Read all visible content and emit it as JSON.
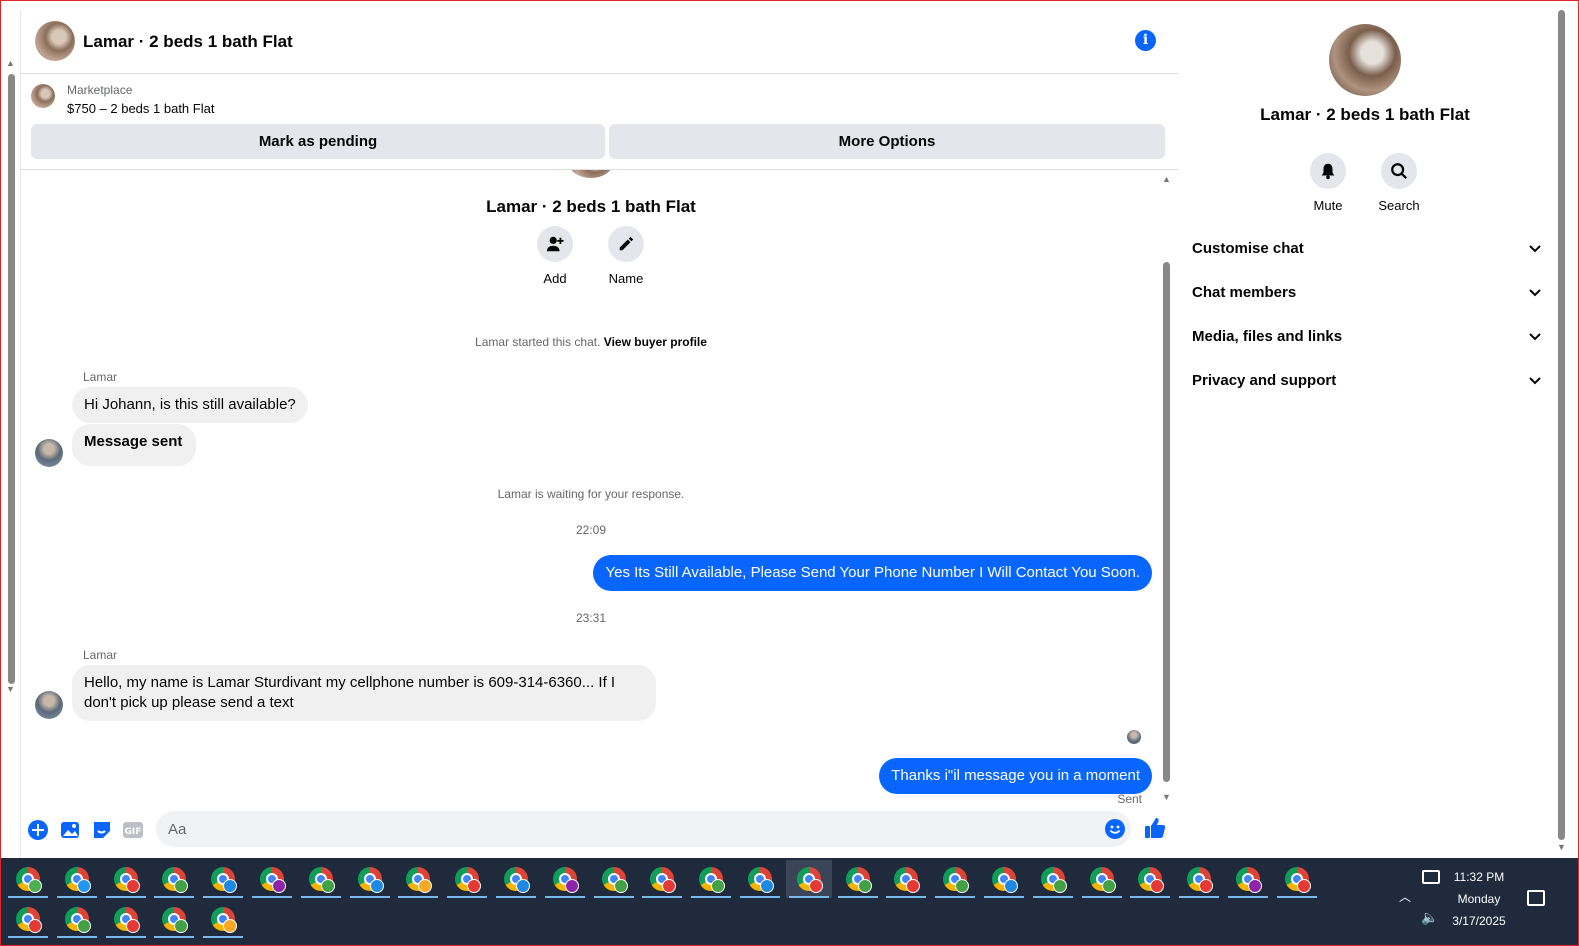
{
  "header": {
    "title": "Lamar · 2 beds 1 bath Flat"
  },
  "marketplace": {
    "label": "Marketplace",
    "listing": "$750 – 2 beds 1 bath Flat",
    "mark_pending": "Mark as pending",
    "more_options": "More Options"
  },
  "profile": {
    "name": "Lamar · 2 beds 1 bath Flat",
    "add_label": "Add",
    "name_label": "Name"
  },
  "conversation": {
    "started_prefix": "Lamar started this chat.",
    "view_buyer_profile": "View buyer profile",
    "sender_1": "Lamar",
    "msg_1": "Hi Johann, is this still available?",
    "msg_2": "Message sent",
    "waiting": "Lamar is waiting for your response.",
    "time_1": "22:09",
    "reply_1": "Yes Its Still Available, Please Send Your Phone Number I Will Contact You Soon.",
    "time_2": "23:31",
    "sender_2": "Lamar",
    "msg_3": "Hello, my name is Lamar Sturdivant my cellphone number is 609-314-6360... If I don't pick up please send a text",
    "reply_2": "Thanks i\"il message you in a moment",
    "sent_status": "Sent"
  },
  "composer": {
    "placeholder": "Aa"
  },
  "details": {
    "name": "Lamar · 2 beds 1 bath Flat",
    "mute_label": "Mute",
    "search_label": "Search",
    "sections": [
      "Customise chat",
      "Chat members",
      "Media, files and links",
      "Privacy and support"
    ]
  },
  "taskbar": {
    "time": "11:32 PM",
    "day": "Monday",
    "date": "3/17/2025",
    "profile_colors": [
      "#4caf50",
      "#2196f3",
      "#e53935",
      "#43a047",
      "#1e88e5",
      "#8e24aa",
      "#43a047",
      "#1e88e5",
      "#f9a825",
      "#e53935",
      "#1e88e5",
      "#8e24aa",
      "#43a047",
      "#e53935",
      "#43a047",
      "#1e88e5",
      "#e53935",
      "#43a047",
      "#e53935",
      "#43a047",
      "#1e88e5",
      "#43a047",
      "#43a047",
      "#e53935",
      "#e53935",
      "#8e24aa",
      "#e53935",
      "#e53935",
      "#43a047",
      "#e53935",
      "#43a047",
      "#f9a825"
    ],
    "brand_accent": "#0866ff"
  }
}
